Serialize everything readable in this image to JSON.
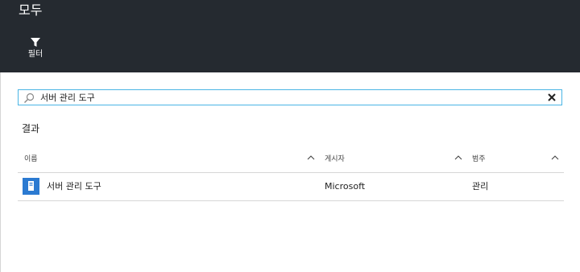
{
  "header": {
    "title": "모두",
    "filter_label": "필터"
  },
  "search": {
    "value": "서버 관리 도구",
    "placeholder": ""
  },
  "results": {
    "label": "결과",
    "columns": [
      "이름",
      "게시자",
      "범주"
    ],
    "rows": [
      {
        "name": "서버 관리 도구",
        "publisher": "Microsoft",
        "category": "관리",
        "icon": "server-app-icon"
      }
    ]
  },
  "colors": {
    "header_bg": "#252a30",
    "search_border": "#4ab5e5",
    "app_icon": "#2b7ad1"
  }
}
